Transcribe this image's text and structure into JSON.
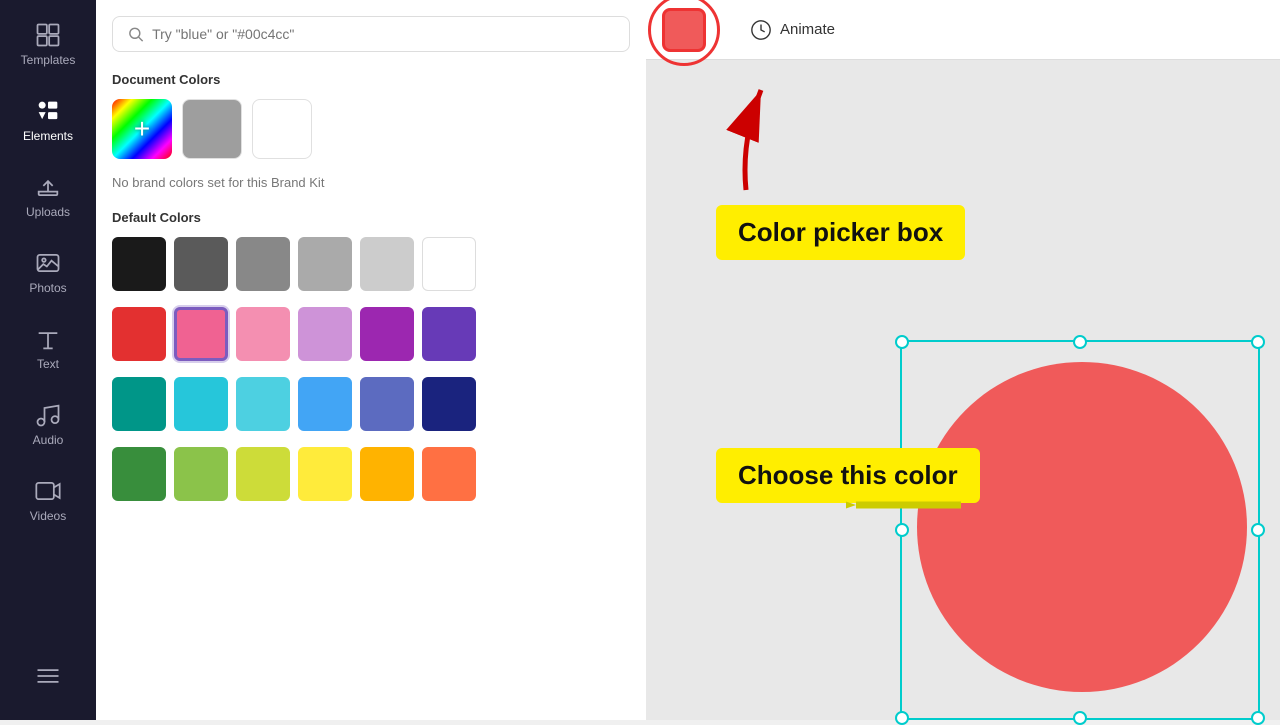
{
  "sidebar": {
    "items": [
      {
        "id": "templates",
        "label": "Templates",
        "icon": "grid"
      },
      {
        "id": "elements",
        "label": "Elements",
        "icon": "elements"
      },
      {
        "id": "uploads",
        "label": "Uploads",
        "icon": "upload"
      },
      {
        "id": "photos",
        "label": "Photos",
        "icon": "photo"
      },
      {
        "id": "text",
        "label": "Text",
        "icon": "text"
      },
      {
        "id": "audio",
        "label": "Audio",
        "icon": "audio"
      },
      {
        "id": "videos",
        "label": "Videos",
        "icon": "video"
      },
      {
        "id": "more",
        "label": "",
        "icon": "lines"
      }
    ]
  },
  "panel": {
    "search_placeholder": "Try \"blue\" or \"#00c4cc\"",
    "document_colors_label": "Document Colors",
    "no_brand_text": "No brand colors set for this Brand Kit",
    "default_colors_label": "Default Colors",
    "document_colors": [
      {
        "color": "gradient",
        "is_add": true
      },
      {
        "color": "#9e9e9e"
      },
      {
        "color": "#ffffff"
      }
    ],
    "default_colors_row1": [
      {
        "color": "#1a1a1a"
      },
      {
        "color": "#5a5a5a"
      },
      {
        "color": "#888888"
      },
      {
        "color": "#aaaaaa"
      },
      {
        "color": "#cccccc"
      },
      {
        "color": "#ffffff"
      }
    ],
    "default_colors_row2": [
      {
        "color": "#e33030",
        "label": "red"
      },
      {
        "color": "#f06292",
        "label": "pink-selected",
        "selected": true
      },
      {
        "color": "#f48fb1",
        "label": "light-pink"
      },
      {
        "color": "#ce93d8",
        "label": "light-purple"
      },
      {
        "color": "#9c27b0",
        "label": "purple"
      },
      {
        "color": "#673ab7",
        "label": "deep-purple"
      }
    ],
    "default_colors_row3": [
      {
        "color": "#009688"
      },
      {
        "color": "#26c6da"
      },
      {
        "color": "#4dd0e1"
      },
      {
        "color": "#42a5f5"
      },
      {
        "color": "#5c6bc0"
      },
      {
        "color": "#1a237e"
      }
    ],
    "default_colors_row4": [
      {
        "color": "#388e3c"
      },
      {
        "color": "#8bc34a"
      },
      {
        "color": "#cddc39"
      },
      {
        "color": "#ffeb3b"
      },
      {
        "color": "#ffb300"
      },
      {
        "color": "#ff7043"
      }
    ]
  },
  "toolbar": {
    "color_value": "#f05a5a",
    "animate_label": "Animate"
  },
  "annotations": {
    "color_picker_box": "Color picker box",
    "choose_color": "Choose this color"
  },
  "canvas": {
    "circle_color": "#f05a5a"
  }
}
